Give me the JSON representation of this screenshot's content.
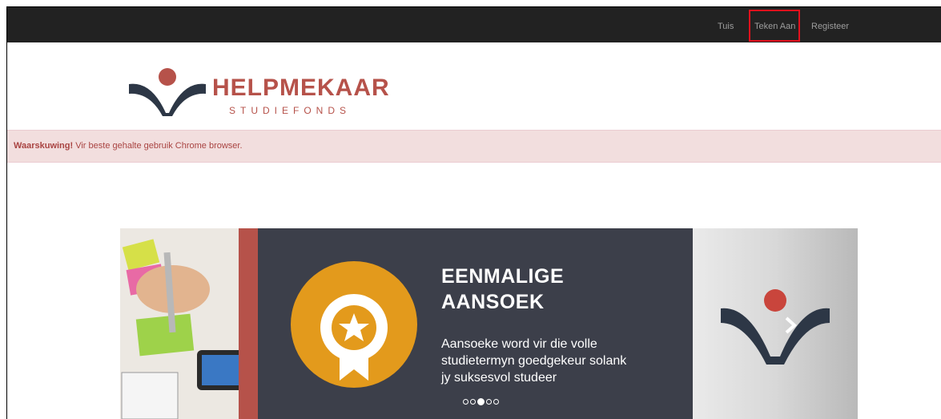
{
  "nav": {
    "items": [
      {
        "label": "Tuis"
      },
      {
        "label": "Teken Aan"
      },
      {
        "label": "Registeer"
      }
    ],
    "highlight_color": "#e3111d"
  },
  "logo": {
    "name": "HELPMEKAAR",
    "tagline": "STUDIEFONDS",
    "brand_color": "#b6524a",
    "navy": "#2d3746"
  },
  "alert": {
    "strong": "Waarskuwing!",
    "text": " Vir beste gehalte gebruik Chrome browser."
  },
  "carousel": {
    "heading_line1": "EENMALIGE",
    "heading_line2": "AANSOEK",
    "body_line1": "Aansoeke word vir die volle",
    "body_line2": "studietermyn goedgekeur solank",
    "body_line3": "jy suksesvol studeer",
    "slide_count": 5,
    "active_index": 2,
    "badge_color": "#e39a1c",
    "panel_color": "#3c3f4a",
    "next_icon": "chevron-right-icon",
    "badge_icon": "award-ribbon-icon"
  }
}
